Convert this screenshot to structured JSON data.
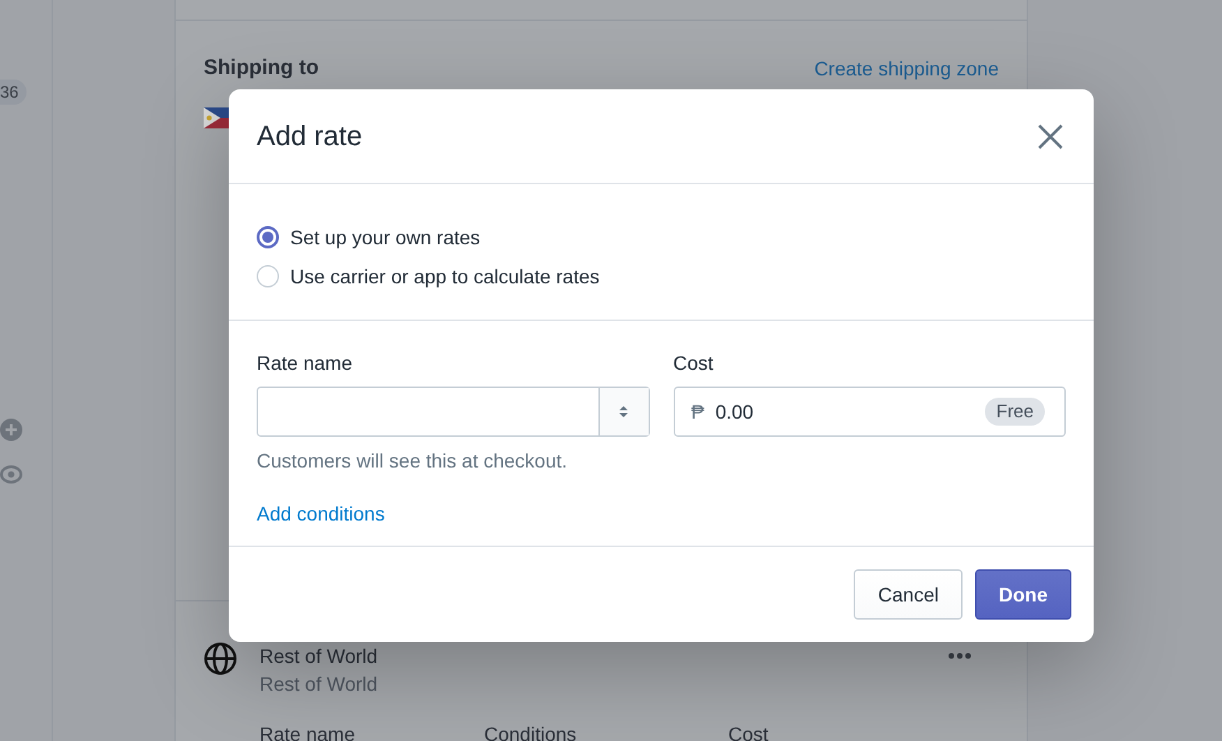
{
  "sidebar": {
    "badge": "36"
  },
  "shipping_section": {
    "title": "Shipping to",
    "link": "Create shipping zone"
  },
  "zone": {
    "name": "Rest of World",
    "subtitle": "Rest of World",
    "table_columns": [
      "Rate name",
      "Conditions",
      "Cost"
    ]
  },
  "dialog": {
    "title": "Add rate",
    "rate_options": [
      {
        "label": "Set up your own rates",
        "selected": true
      },
      {
        "label": "Use carrier or app to calculate rates",
        "selected": false
      }
    ],
    "rate_name": {
      "label": "Rate name",
      "help": "Customers will see this at checkout."
    },
    "cost": {
      "label": "Cost",
      "currency": "₱",
      "value": "0.00",
      "badge": "Free"
    },
    "link": "Add conditions",
    "buttons": [
      {
        "label": "Cancel",
        "kind": "secondary"
      },
      {
        "label": "Done",
        "kind": "primary"
      }
    ]
  }
}
